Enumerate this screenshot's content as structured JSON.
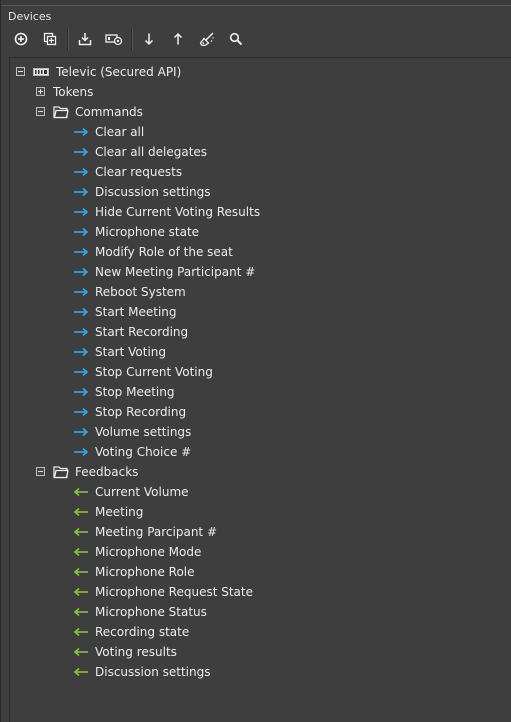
{
  "panel": {
    "title": "Devices"
  },
  "toolbar": {
    "buttons": [
      {
        "icon": "add-circle-icon"
      },
      {
        "icon": "duplicate-icon"
      },
      {
        "icon": "import-icon"
      },
      {
        "icon": "device-settings-icon"
      },
      {
        "icon": "move-down-icon"
      },
      {
        "icon": "move-up-icon"
      },
      {
        "icon": "clean-icon"
      },
      {
        "icon": "search-icon"
      }
    ]
  },
  "tree": {
    "root": {
      "label": "Televic (Secured API)",
      "expanded": true
    },
    "tokens": {
      "label": "Tokens",
      "expanded": false
    },
    "commands": {
      "label": "Commands",
      "expanded": true,
      "arrow_color": "#3aa8ee",
      "items": [
        "Clear all",
        "Clear all delegates",
        "Clear requests",
        "Discussion settings",
        "Hide Current Voting Results",
        "Microphone state",
        "Modify Role of the seat",
        "New Meeting Participant #",
        "Reboot System",
        "Start Meeting",
        "Start Recording",
        "Start Voting",
        "Stop Current Voting",
        "Stop Meeting",
        "Stop Recording",
        "Volume settings",
        "Voting Choice #"
      ]
    },
    "feedbacks": {
      "label": "Feedbacks",
      "expanded": true,
      "arrow_color": "#8cc63f",
      "items": [
        "Current Volume",
        "Meeting",
        "Meeting Parcipant #",
        "Microphone Mode",
        "Microphone Role",
        "Microphone Request State",
        "Microphone Status",
        "Recording state",
        "Voting results",
        "Discussion settings"
      ]
    }
  }
}
